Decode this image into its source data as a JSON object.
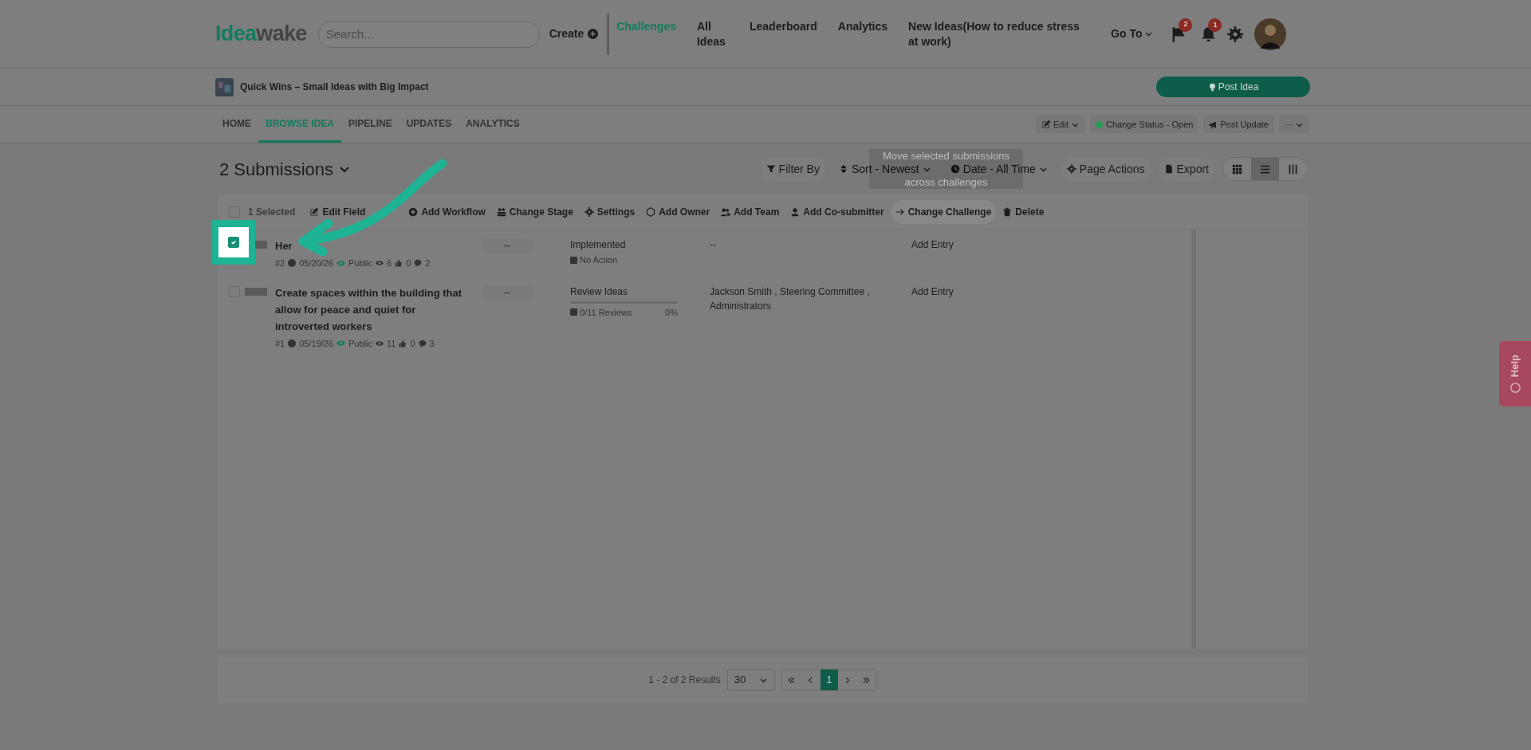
{
  "header": {
    "logo_left": "Idea",
    "logo_right": "wake",
    "search": {
      "placeholder": "Search..."
    },
    "create": "Create",
    "nav": [
      {
        "label": "Challenges",
        "selected": true
      },
      {
        "label": "All Ideas",
        "selected": false
      },
      {
        "label": "Leaderboard",
        "selected": false
      },
      {
        "label": "Analytics",
        "selected": false
      },
      {
        "label": "New Ideas(How to reduce stress at work)",
        "selected": false
      }
    ],
    "goto": "Go To",
    "flag_badge": "2",
    "bell_badge": "1"
  },
  "challenge": {
    "title": "Quick Wins – Small Ideas with Big Impact",
    "post_idea": "Post Idea"
  },
  "tabs": [
    {
      "label": "HOME",
      "selected": false
    },
    {
      "label": "BROWSE IDEA",
      "selected": true
    },
    {
      "label": "PIPELINE",
      "selected": false
    },
    {
      "label": "UPDATES",
      "selected": false
    },
    {
      "label": "ANALYTICS",
      "selected": false
    }
  ],
  "tab_actions": {
    "edit": "Edit",
    "status": "Change Status - Open",
    "post_update": "Post Update",
    "more": "···"
  },
  "submissions_title": "2 Submissions",
  "toolbar": [
    {
      "kind": "filter",
      "label": "Filter By"
    },
    {
      "kind": "sort",
      "label": "Sort - Newest"
    },
    {
      "kind": "date",
      "label": "Date - All Time"
    },
    {
      "kind": "gear",
      "label": "Page Actions"
    },
    {
      "kind": "file",
      "label": "Export"
    }
  ],
  "views": [
    {
      "kind": "grid",
      "selected": false
    },
    {
      "kind": "list",
      "selected": true
    },
    {
      "kind": "columns",
      "selected": false
    }
  ],
  "tooltip": {
    "line_1": "Move selected submissions",
    "line_2": "across challenges"
  },
  "bulk": {
    "checked": false,
    "selected_count": "1 Selected",
    "actions": [
      {
        "kind": "edit",
        "label": "Edit Field"
      },
      {
        "kind": "plus",
        "label": "Add Workflow"
      },
      {
        "kind": "stage",
        "label": "Change Stage"
      },
      {
        "kind": "gear",
        "label": "Settings"
      },
      {
        "kind": "cube",
        "label": "Add Owner"
      },
      {
        "kind": "team",
        "label": "Add Team"
      },
      {
        "kind": "user",
        "label": "Add Co-submitter"
      },
      {
        "kind": "arrow",
        "label": "Change Challenge",
        "selected": true
      },
      {
        "kind": "trash",
        "label": "Delete"
      }
    ]
  },
  "rows": [
    {
      "checked": true,
      "title": "Her",
      "number": "#2",
      "date": "05/20/26",
      "visibility": "Public",
      "views": "6",
      "likes": "0",
      "comments": "2",
      "pill": "--",
      "stage": "Implemented",
      "kind": "action",
      "note": "No Action",
      "people": "--",
      "entry": "Add Entry"
    },
    {
      "checked": false,
      "title": "Create spaces within the building that allow for peace and quiet for introverted workers",
      "number": "#1",
      "date": "05/19/26",
      "visibility": "Public",
      "views": "11",
      "likes": "0",
      "comments": "3",
      "pill": "--",
      "stage": "Review Ideas",
      "kind": "review",
      "note": "0/11 Reviews",
      "level": 0,
      "percent": "0%",
      "people": "Jackson Smith , Steering Committee , Administrators",
      "entry": "Add Entry"
    }
  ],
  "pagination": {
    "results": "1 - 2 of 2 Results",
    "per_page": "30",
    "pages": [
      {
        "label": "1",
        "selected": true
      }
    ]
  },
  "help": "Help"
}
